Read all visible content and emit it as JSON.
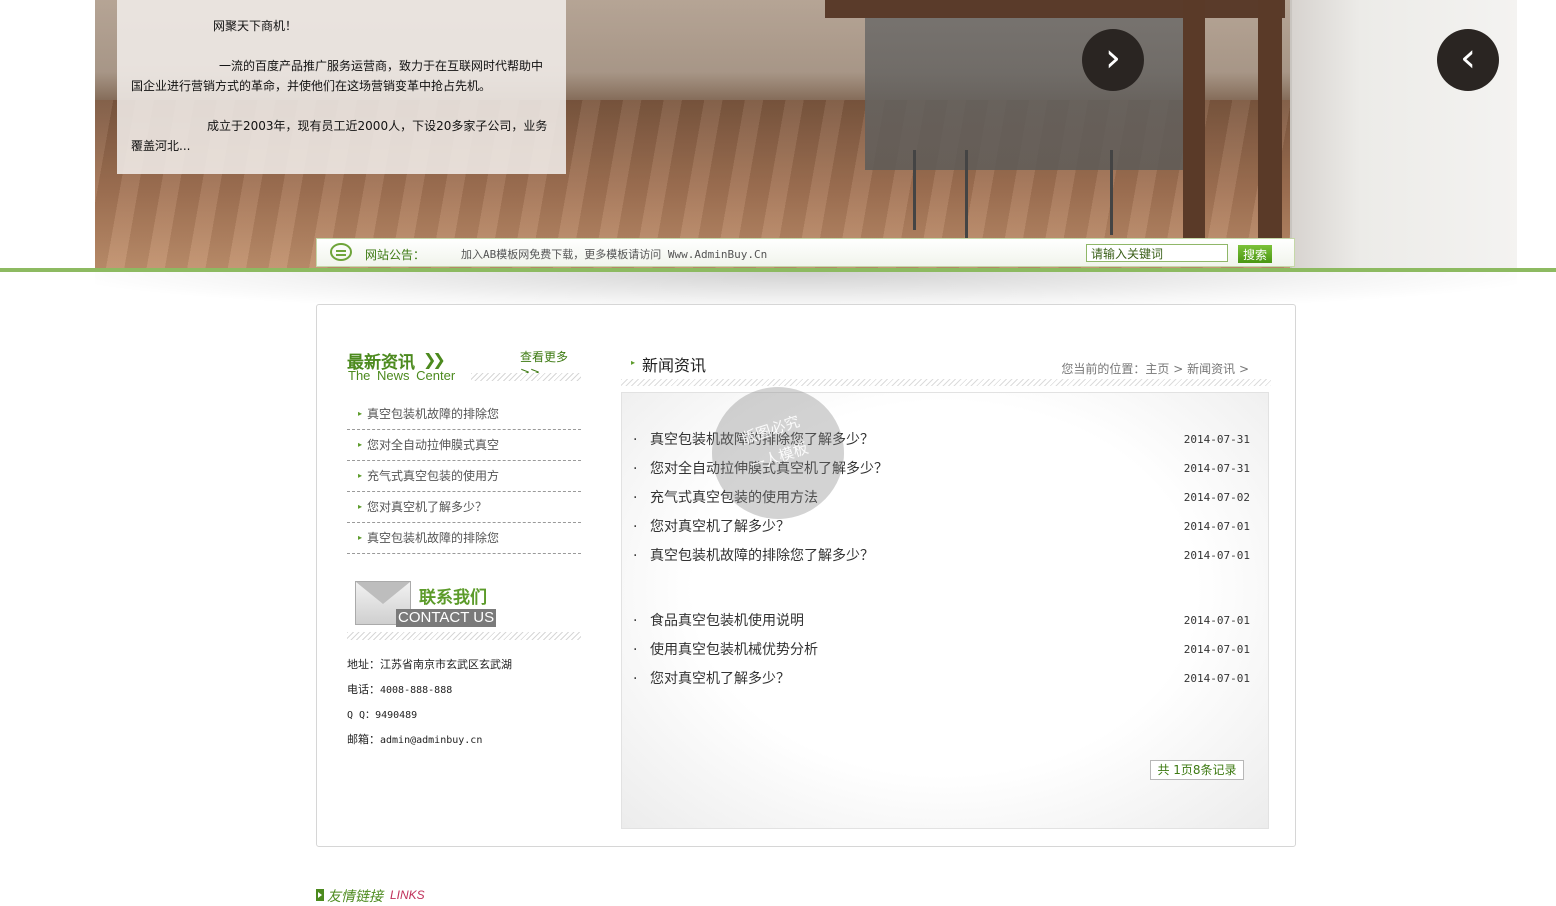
{
  "banner": {
    "intro_title": "网聚天下商机！",
    "intro_p1": "一流的百度产品推广服务运营商，致力于在互联网时代帮助中国企业进行营销方式的革命，并使他们在这场营销变革中抢占先机。",
    "intro_p2": "成立于2003年，现有员工近2000人，下设20多家子公司，业务覆盖河北...",
    "next_icon": "›",
    "prev_icon": "‹"
  },
  "notice": {
    "label": "网站公告：",
    "text": "加入AB模板网免费下载，更多模板请访问 Www.AdminBuy.Cn",
    "search_placeholder": "请输入关键词",
    "search_button": "搜索"
  },
  "sidebar": {
    "news_title_cn": "最新资讯",
    "news_title_en": "The News Center",
    "more_label": "查看更多>>",
    "items": [
      {
        "label": "真空包装机故障的排除您"
      },
      {
        "label": "您对全自动拉伸膜式真空"
      },
      {
        "label": "充气式真空包装的使用方"
      },
      {
        "label": "您对真空机了解多少？"
      },
      {
        "label": "真空包装机故障的排除您"
      }
    ],
    "contact_title_cn": "联系我们",
    "contact_title_en": "CONTACT US",
    "contact": {
      "address_label": "地址：",
      "address": "江苏省南京市玄武区玄武湖",
      "phone_label": "电话：",
      "phone": "4008-888-888",
      "qq_label": "Q Q：",
      "qq": "9490489",
      "email_label": "邮箱：",
      "email": "admin@adminbuy.cn"
    }
  },
  "main": {
    "section_title": "新闻资讯",
    "breadcrumb": {
      "prefix": "您当前的位置：",
      "home": "主页",
      "current": "新闻资讯",
      "separator": ">"
    },
    "news": [
      {
        "title": "真空包装机故障的排除您了解多少？",
        "date": "2014-07-31"
      },
      {
        "title": "您对全自动拉伸膜式真空机了解多少？",
        "date": "2014-07-31"
      },
      {
        "title": "充气式真空包装的使用方法",
        "date": "2014-07-02"
      },
      {
        "title": "您对真空机了解多少？",
        "date": "2014-07-01"
      },
      {
        "title": "真空包装机故障的排除您了解多少？",
        "date": "2014-07-01"
      },
      {
        "title": "食品真空包装机使用说明",
        "date": "2014-07-01"
      },
      {
        "title": "使用真空包装机械优势分析",
        "date": "2014-07-01"
      },
      {
        "title": "您对真空机了解多少？",
        "date": "2014-07-01"
      }
    ],
    "pager": "共 1页8条记录"
  },
  "links": {
    "title_cn": "友情链接",
    "title_en": "LINKS"
  },
  "watermark": {
    "line1": "版图必究",
    "line2": "一人模板"
  },
  "colors": {
    "brand_green": "#4c8a1e",
    "accent_line": "#8dba61",
    "links_en": "#c0305a"
  }
}
